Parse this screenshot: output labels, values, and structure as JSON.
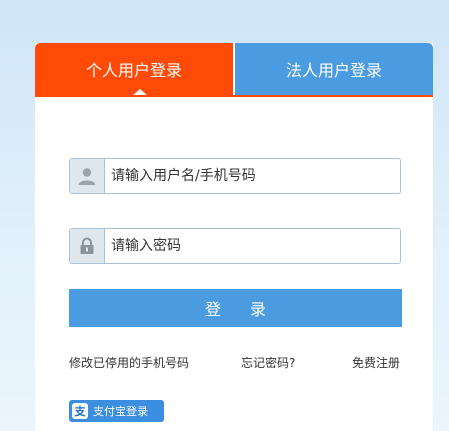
{
  "tabs": {
    "personal": "个人用户登录",
    "legal": "法人用户登录"
  },
  "form": {
    "username_placeholder": "请输入用户名/手机号码",
    "password_placeholder": "请输入密码",
    "user_icon": "user-icon",
    "lock_icon": "lock-icon"
  },
  "login_button": "登 录",
  "links": {
    "changed_phone": "修改已停用的手机号码",
    "forgot_password": "忘记密码?",
    "register": "免费注册"
  },
  "alipay": {
    "icon_text": "支",
    "label": "支付宝登录"
  },
  "colors": {
    "tab_active": "#ff4b07",
    "tab_inactive": "#4a9be0",
    "button": "#4a9be0"
  }
}
